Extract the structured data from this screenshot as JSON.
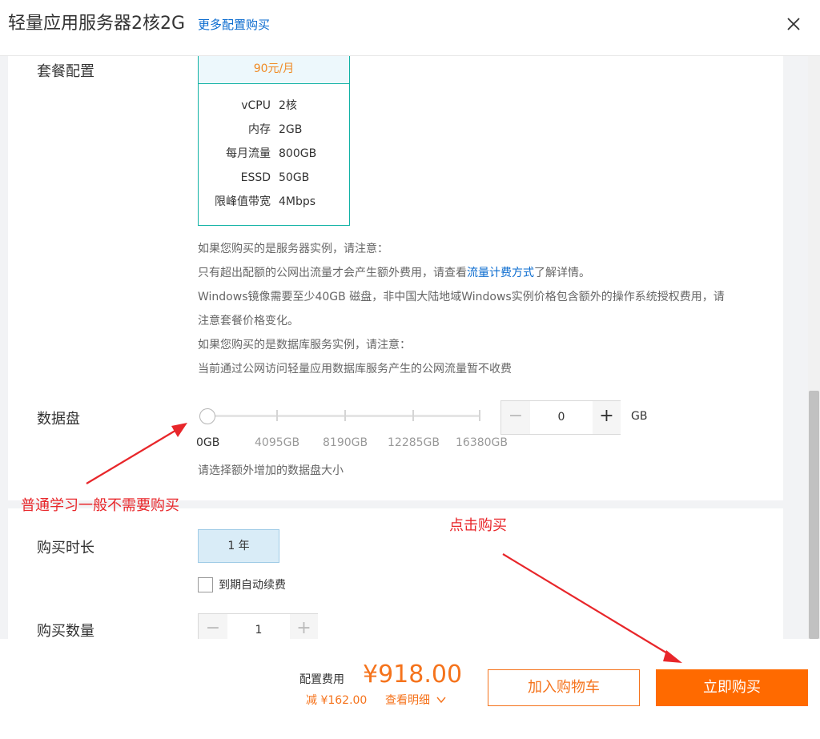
{
  "header": {
    "title": "轻量应用服务器2核2G",
    "more_link": "更多配置购买"
  },
  "plan": {
    "label": "套餐配置",
    "price": "90元/月",
    "specs": [
      {
        "key": "vCPU",
        "value": "2核"
      },
      {
        "key": "内存",
        "value": "2GB"
      },
      {
        "key": "每月流量",
        "value": "800GB"
      },
      {
        "key": "ESSD",
        "value": "50GB"
      },
      {
        "key": "限峰值带宽",
        "value": "4Mbps"
      }
    ]
  },
  "notes": {
    "line1": "如果您购买的是服务器实例，请注意：",
    "line2_a": "只有超出配额的公网出流量才会产生额外费用，请查看",
    "line2_link": "流量计费方式",
    "line2_b": "了解详情。",
    "line3": "Windows镜像需要至少40GB 磁盘，非中国大陆地域Windows实例价格包含额外的操作系统授权费用，请",
    "line4": "注意套餐价格变化。",
    "line5": "如果您购买的是数据库服务实例，请注意：",
    "line6": "当前通过公网访问轻量应用数据库服务产生的公网流量暂不收费"
  },
  "data_disk": {
    "label": "数据盘",
    "slider_ticks": [
      "0GB",
      "4095GB",
      "8190GB",
      "12285GB",
      "16380GB"
    ],
    "slider_value_fraction": 0,
    "value": "0",
    "minus": "−",
    "plus": "+",
    "unit": "GB",
    "hint": "请选择额外增加的数据盘大小"
  },
  "duration": {
    "label": "购买时长",
    "selected": "1 年",
    "auto_renew_label": "到期自动续费"
  },
  "quantity": {
    "label": "购买数量",
    "value": "1",
    "minus": "−",
    "plus": "+"
  },
  "footer": {
    "fee_label": "配置费用",
    "price": "¥918.00",
    "discount": "减 ¥162.00",
    "detail_link": "查看明细",
    "add_to_cart": "加入购物车",
    "buy_now": "立即购买"
  },
  "annotations": {
    "note_left": "普通学习一般不需要购买",
    "note_right": "点击购买"
  },
  "colors": {
    "accent_orange": "#ff6a00",
    "link_blue": "#0a6bcf",
    "plan_border": "#11b2a5",
    "annotation_red": "#e8262a"
  },
  "icons": {
    "close": "close-icon",
    "detail_chevron": "chevron-down-icon",
    "arrow": "arrow-annotation"
  }
}
